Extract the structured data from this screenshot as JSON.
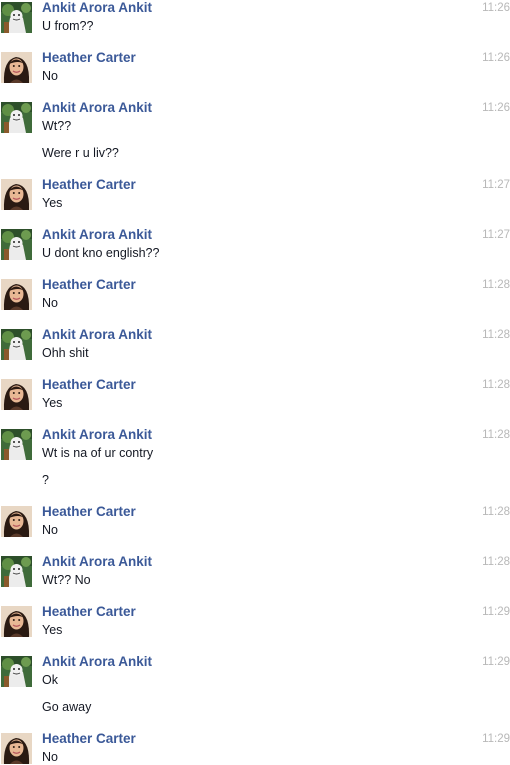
{
  "conversation": {
    "messages": [
      {
        "sender": "Ankit Arora Ankit",
        "avatar": "ankit",
        "time": "11:26",
        "lines": [
          "U from??"
        ]
      },
      {
        "sender": "Heather Carter",
        "avatar": "heather",
        "time": "11:26",
        "lines": [
          "No"
        ]
      },
      {
        "sender": "Ankit Arora Ankit",
        "avatar": "ankit",
        "time": "11:26",
        "lines": [
          "Wt??",
          "Were r u liv??"
        ]
      },
      {
        "sender": "Heather Carter",
        "avatar": "heather",
        "time": "11:27",
        "lines": [
          "Yes"
        ]
      },
      {
        "sender": "Ankit Arora Ankit",
        "avatar": "ankit",
        "time": "11:27",
        "lines": [
          "U dont kno english??"
        ]
      },
      {
        "sender": "Heather Carter",
        "avatar": "heather",
        "time": "11:28",
        "lines": [
          "No"
        ]
      },
      {
        "sender": "Ankit Arora Ankit",
        "avatar": "ankit",
        "time": "11:28",
        "lines": [
          "Ohh shit"
        ]
      },
      {
        "sender": "Heather Carter",
        "avatar": "heather",
        "time": "11:28",
        "lines": [
          "Yes"
        ]
      },
      {
        "sender": "Ankit Arora Ankit",
        "avatar": "ankit",
        "time": "11:28",
        "lines": [
          "Wt is na of ur contry",
          "?"
        ]
      },
      {
        "sender": "Heather Carter",
        "avatar": "heather",
        "time": "11:28",
        "lines": [
          "No"
        ]
      },
      {
        "sender": "Ankit Arora Ankit",
        "avatar": "ankit",
        "time": "11:28",
        "lines": [
          "Wt?? No"
        ]
      },
      {
        "sender": "Heather Carter",
        "avatar": "heather",
        "time": "11:29",
        "lines": [
          "Yes"
        ]
      },
      {
        "sender": "Ankit Arora Ankit",
        "avatar": "ankit",
        "time": "11:29",
        "lines": [
          "Ok",
          "Go away"
        ]
      },
      {
        "sender": "Heather Carter",
        "avatar": "heather",
        "time": "11:29",
        "lines": [
          "No"
        ]
      }
    ]
  },
  "icons": {
    "ankit": "ankit-avatar-icon",
    "heather": "heather-avatar-icon"
  },
  "colors": {
    "sender_name": "#3b5998",
    "message_text": "#141823",
    "timestamp": "#b8b8b8",
    "background": "#ffffff"
  }
}
